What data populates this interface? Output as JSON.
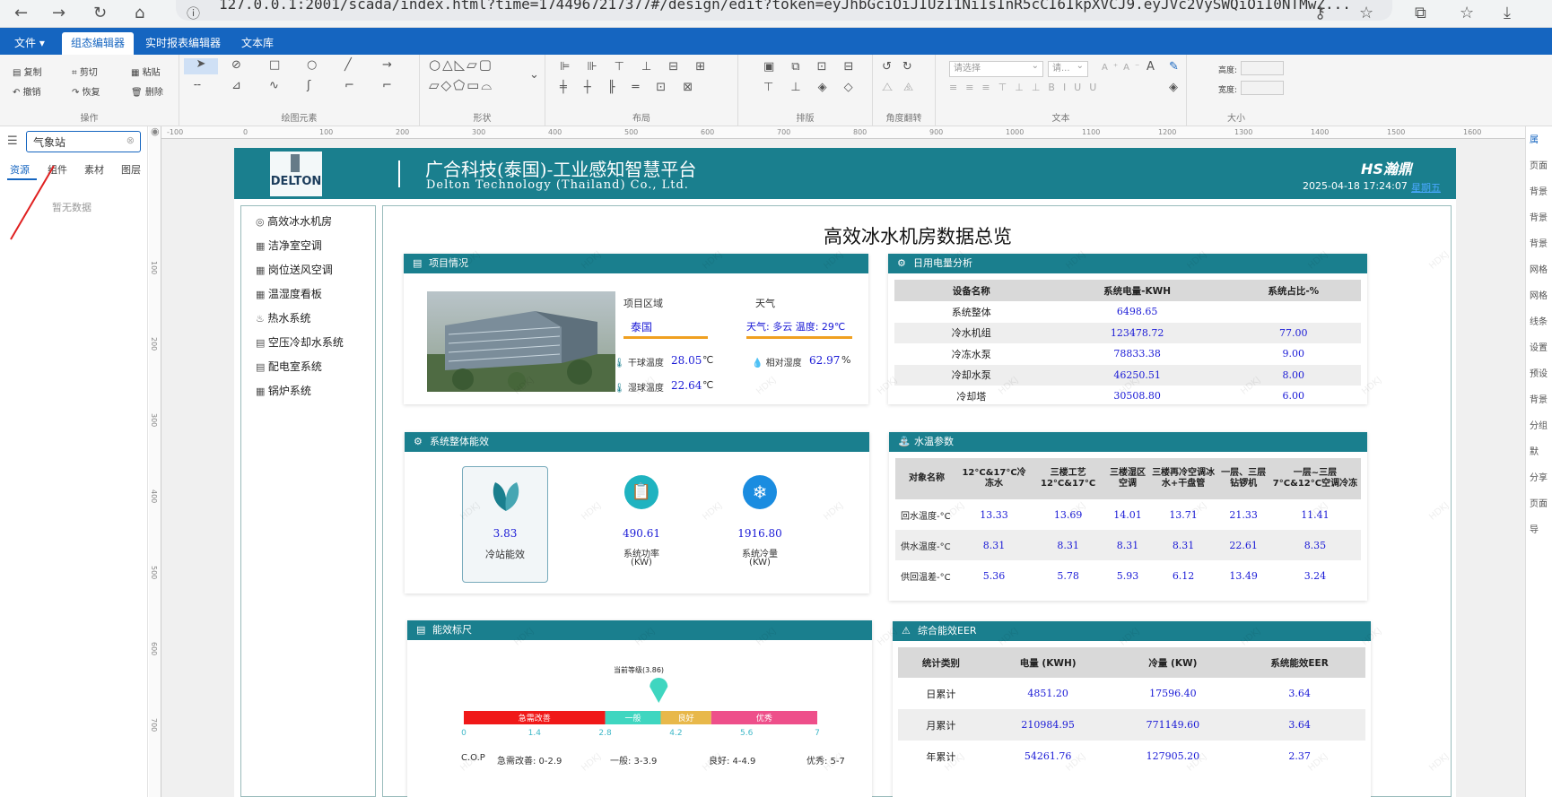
{
  "browser": {
    "url": "127.0.0.1:2001/scada/index.html?time=1744967217377#/design/edit?token=eyJhbGciOiJIUzI1NiIsInR5cCI6IkpXVCJ9.eyJVc2VySWQiOiI0NTMwZ..."
  },
  "menu": {
    "file": "文件 ▾",
    "tabs": [
      "组态编辑器",
      "实时报表编辑器",
      "文本库"
    ]
  },
  "toolbar": {
    "ops": {
      "copy": "复制",
      "cut": "剪切",
      "paste": "粘贴",
      "undo": "撤销",
      "redo": "恢复",
      "delete": "删除",
      "label": "操作"
    },
    "draw_label": "绘图元素",
    "shape_label": "形状",
    "layout_label": "布局",
    "arrange_label": "排版",
    "rotate_label": "角度翻转",
    "text": {
      "select1": "请选择",
      "select2": "请...",
      "label": "文本"
    },
    "size": {
      "height": "高度:",
      "width": "宽度:",
      "label": "大小"
    }
  },
  "left": {
    "search_value": "气象站",
    "tabs": [
      "资源",
      "组件",
      "素材",
      "图层"
    ],
    "empty": "暂无数据"
  },
  "ruler": {
    "h": [
      "-100",
      "0",
      "100",
      "200",
      "300",
      "400",
      "500",
      "600",
      "700",
      "800",
      "900",
      "1000",
      "1100",
      "1200",
      "1300",
      "1400",
      "1500",
      "1600"
    ],
    "v": [
      "100",
      "200",
      "300",
      "400",
      "500",
      "600",
      "700"
    ]
  },
  "right_panel": [
    "属",
    "页面",
    "背景",
    "背景",
    "背景",
    "网格",
    "网格",
    "线条",
    "设置",
    "预设",
    "背景",
    "分组",
    "默",
    "分享",
    "页面",
    "导"
  ],
  "scada": {
    "logo": "DELTON",
    "title": "广合科技(泰国)-工业感知智慧平台",
    "subtitle": "Delton Technology (Thailand) Co., Ltd.",
    "brand": "HS瀚鼎",
    "datetime": "2025-04-18 17:24:07",
    "weekday": "星期五",
    "nav": [
      "高效冰水机房",
      "洁净室空调",
      "岗位送风空调",
      "温湿度看板",
      "热水系统",
      "空压冷却水系统",
      "配电室系统",
      "锅炉系统"
    ],
    "page_title": "高效冰水机房数据总览",
    "watermark": "HDKJ",
    "project": {
      "title": "项目情况",
      "region_label": "项目区域",
      "region": "泰国",
      "weather_label": "天气",
      "weather": "天气: 多云  温度: 29℃",
      "dry_label": "干球温度",
      "dry": "28.05",
      "wet_label": "湿球温度",
      "wet": "22.64",
      "rh_label": "相对湿度",
      "rh": "62.97",
      "unit_c": "℃",
      "unit_p": "%"
    },
    "power": {
      "title": "日用电量分析",
      "headers": [
        "设备名称",
        "系统电量-KWH",
        "系统占比-%"
      ],
      "rows": [
        [
          "系统整体",
          "6498.65",
          ""
        ],
        [
          "冷水机组",
          "123478.72",
          "77.00"
        ],
        [
          "冷冻水泵",
          "78833.38",
          "9.00"
        ],
        [
          "冷却水泵",
          "46250.51",
          "8.00"
        ],
        [
          "冷却塔",
          "30508.80",
          "6.00"
        ]
      ]
    },
    "efficiency": {
      "title": "系统整体能效",
      "items": [
        {
          "value": "3.83",
          "label": "冷站能效",
          "unit": ""
        },
        {
          "value": "490.61",
          "label": "系统功率",
          "unit": "(KW)"
        },
        {
          "value": "1916.80",
          "label": "系统冷量",
          "unit": "(KW)"
        }
      ]
    },
    "water": {
      "title": "水温参数",
      "headers": [
        "对象名称",
        "12°C&17°C冷冻水",
        "三楼工艺12°C&17°C",
        "三楼湿区空调",
        "三楼再冷空调冰水+干盘管",
        "一层、三层钻锣机",
        "一层~三层7°C&12°C空调冷冻"
      ],
      "rows": [
        [
          "回水温度-°C",
          "13.33",
          "13.69",
          "14.01",
          "13.71",
          "21.33",
          "11.41"
        ],
        [
          "供水温度-°C",
          "8.31",
          "8.31",
          "8.31",
          "8.31",
          "22.61",
          "8.35"
        ],
        [
          "供回温差-°C",
          "5.36",
          "5.78",
          "5.93",
          "6.12",
          "13.49",
          "3.24"
        ]
      ]
    },
    "scale": {
      "title": "能效标尺",
      "current": "当前等级(3.86)",
      "current_value": 3.86,
      "segments": [
        {
          "label": "急需改善",
          "from": 0,
          "to": 2.8,
          "color": "#f01818"
        },
        {
          "label": "一般",
          "from": 2.8,
          "to": 3.9,
          "color": "#3fd6c0"
        },
        {
          "label": "良好",
          "from": 3.9,
          "to": 4.9,
          "color": "#e8b84a"
        },
        {
          "label": "优秀",
          "from": 4.9,
          "to": 7,
          "color": "#ee4f8a"
        }
      ],
      "ticks": [
        "0",
        "1.4",
        "2.8",
        "4.2",
        "5.6",
        "7"
      ],
      "legend": [
        "C.O.P",
        "急需改善: 0-2.9",
        "一般: 3-3.9",
        "良好: 4-4.9",
        "优秀: 5-7"
      ]
    },
    "eer": {
      "title": "综合能效EER",
      "headers": [
        "统计类别",
        "电量 (KWH)",
        "冷量 (KW)",
        "系统能效EER"
      ],
      "rows": [
        [
          "日累计",
          "4851.20",
          "17596.40",
          "3.64"
        ],
        [
          "月累计",
          "210984.95",
          "771149.60",
          "3.64"
        ],
        [
          "年累计",
          "54261.76",
          "127905.20",
          "2.37"
        ]
      ]
    }
  },
  "colors": {
    "menu": "#1565c0",
    "teal": "#1a7f8e",
    "value": "#1a1ad6",
    "orange": "#f0a020"
  }
}
